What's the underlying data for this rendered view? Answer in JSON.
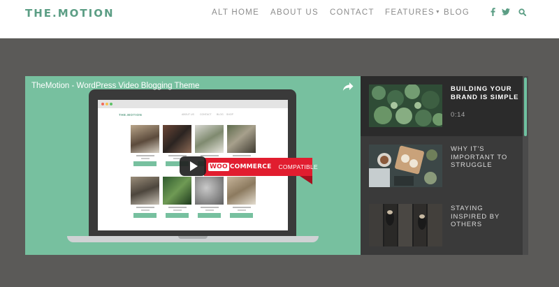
{
  "header": {
    "logo": "THE.MOTION",
    "nav": [
      {
        "label": "ALT HOME"
      },
      {
        "label": "ABOUT US"
      },
      {
        "label": "CONTACT"
      },
      {
        "label": "FEATURES",
        "has_dropdown": true
      },
      {
        "label": "BLOG"
      }
    ],
    "icons": [
      "facebook-icon",
      "twitter-icon",
      "search-icon"
    ],
    "accent_color": "#5c9e85"
  },
  "video": {
    "title": "TheMotion - WordPress Video Blogging Theme",
    "background_color": "#77c09f",
    "screen": {
      "site_logo": "THE.MOTION",
      "nav": [
        "ABOUT US",
        "CONTACT",
        "BLOG",
        "SHOP"
      ]
    },
    "ribbon": {
      "woo": "WOO",
      "commerce": "COMMERCE",
      "compatible": "COMPATIBLE",
      "color": "#e11d2f"
    }
  },
  "playlist": {
    "items": [
      {
        "title": "BUILDING YOUR BRAND IS SIMPLE",
        "time": "0:14",
        "active": true
      },
      {
        "title": "WHY IT'S IMPORTANT TO STRUGGLE",
        "time": "",
        "active": false
      },
      {
        "title": "STAYING INSPIRED BY OTHERS",
        "time": "",
        "active": false
      }
    ],
    "scroll_accent": "#6fc1a0"
  }
}
